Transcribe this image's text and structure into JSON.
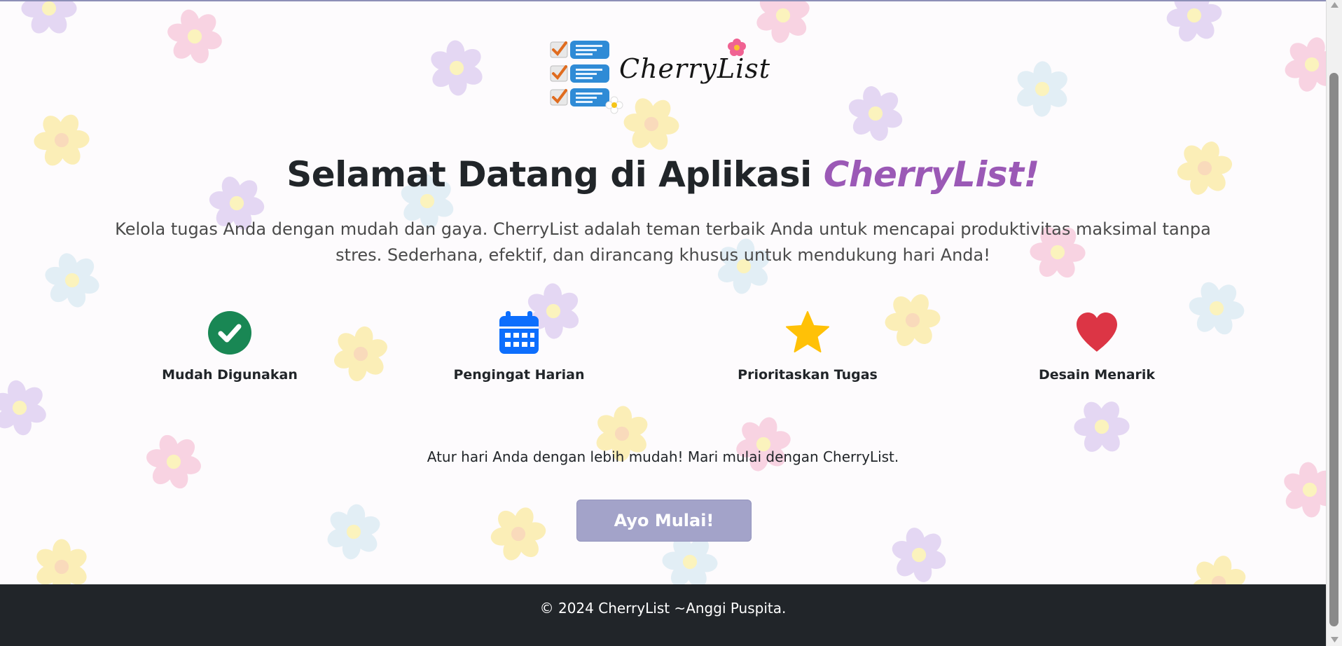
{
  "logo": {
    "wordmark": "CherryList"
  },
  "hero": {
    "title_prefix": "Selamat Datang di Aplikasi",
    "title_accent": "CherryList!",
    "subtitle": "Kelola tugas Anda dengan mudah dan gaya. CherryList adalah teman terbaik Anda untuk mencapai produktivitas maksimal tanpa stres. Sederhana, efektif, dan dirancang khusus untuk mendukung hari Anda!"
  },
  "features": [
    {
      "label": "Mudah Digunakan",
      "icon": "check-circle-icon",
      "color": "#198754"
    },
    {
      "label": "Pengingat Harian",
      "icon": "calendar-icon",
      "color": "#0d6efd"
    },
    {
      "label": "Prioritaskan Tugas",
      "icon": "star-icon",
      "color": "#ffc107"
    },
    {
      "label": "Desain Menarik",
      "icon": "heart-icon",
      "color": "#dc3545"
    }
  ],
  "cta": {
    "text": "Atur hari Anda dengan lebih mudah! Mari mulai dengan CherryList.",
    "button_label": "Ayo Mulai!"
  },
  "footer": {
    "text": "© 2024 CherryList ~Anggi Puspita."
  },
  "colors": {
    "accent": "#9b59b6",
    "button": "#a3a3c9",
    "footer_bg": "#212529"
  }
}
